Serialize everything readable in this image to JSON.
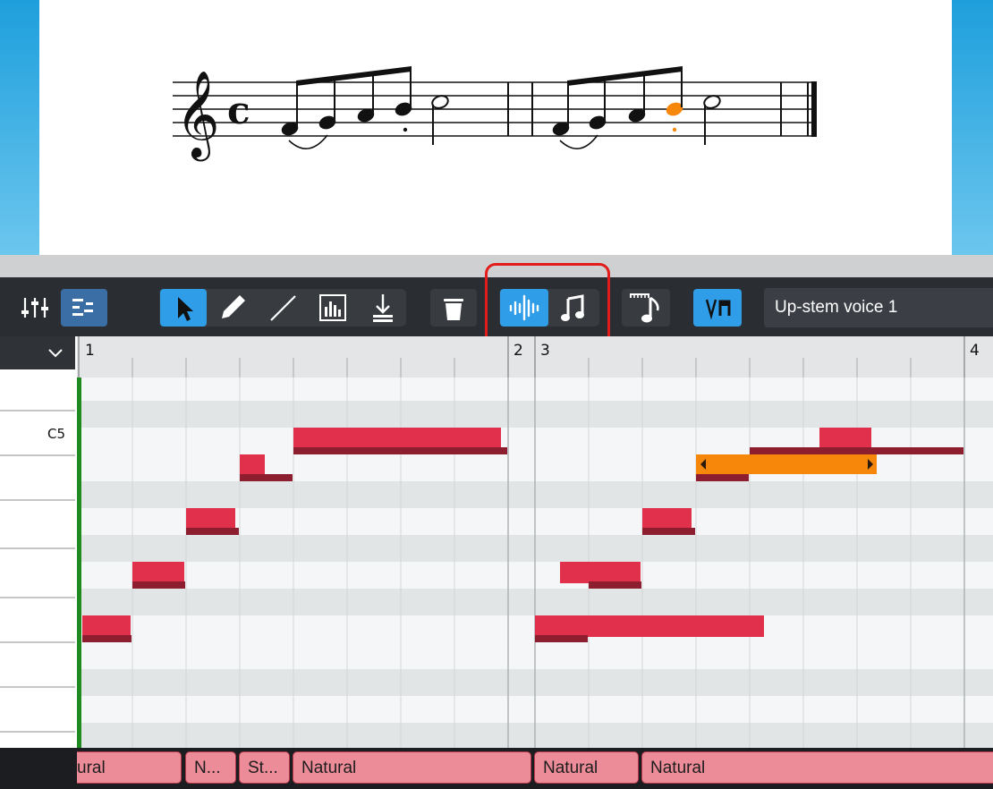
{
  "toolbar": {
    "voice_label": "Up-stem voice 1",
    "buttons": [
      "mixer",
      "piano-roll",
      "select",
      "pencil",
      "line",
      "velocity-box",
      "download",
      "trash",
      "audio-waveform",
      "music-note",
      "tempo-note",
      "stem-direction"
    ],
    "accent_color": "#2f9de8"
  },
  "ruler": {
    "measures": [
      "1",
      "2",
      "3",
      "4"
    ]
  },
  "keys": {
    "c5_label": "C5"
  },
  "velocity_lane": {
    "segments": [
      "ural",
      "N...",
      "St...",
      "Natural",
      "Natural",
      "Natural"
    ]
  },
  "colors": {
    "note": "#e0304c",
    "note_selected": "#f7870b",
    "highlight": "#e21b1b"
  }
}
